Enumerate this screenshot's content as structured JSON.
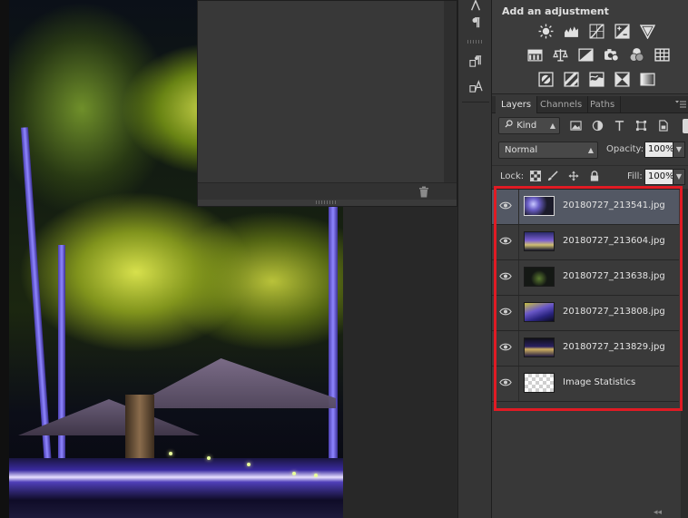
{
  "adjustments": {
    "title": "Add an adjustment",
    "rows": [
      [
        "brightness-contrast-icon",
        "levels-icon",
        "curves-icon",
        "exposure-icon",
        "vibrance-icon"
      ],
      [
        "hue-saturation-icon",
        "color-balance-icon",
        "black-white-icon",
        "photo-filter-icon",
        "channel-mixer-icon",
        "color-lookup-icon"
      ],
      [
        "invert-icon",
        "posterize-icon",
        "threshold-icon",
        "selective-color-icon",
        "gradient-map-icon"
      ]
    ]
  },
  "layers_panel": {
    "tabs": [
      {
        "label": "Layers",
        "active": true
      },
      {
        "label": "Channels",
        "active": false
      },
      {
        "label": "Paths",
        "active": false
      }
    ],
    "filter": {
      "kind_label": "Kind"
    },
    "blend_mode": "Normal",
    "opacity_label": "Opacity:",
    "opacity_value": "100%",
    "lock_label": "Lock:",
    "fill_label": "Fill:",
    "fill_value": "100%",
    "layers": [
      {
        "name": "20180727_213541.jpg",
        "selected": true,
        "visible": true,
        "thumb": "night-photo"
      },
      {
        "name": "20180727_213604.jpg",
        "selected": false,
        "visible": true,
        "thumb": "night-photo"
      },
      {
        "name": "20180727_213638.jpg",
        "selected": false,
        "visible": true,
        "thumb": "night-photo"
      },
      {
        "name": "20180727_213808.jpg",
        "selected": false,
        "visible": true,
        "thumb": "night-photo"
      },
      {
        "name": "20180727_213829.jpg",
        "selected": false,
        "visible": true,
        "thumb": "night-photo"
      },
      {
        "name": "Image Statistics",
        "selected": false,
        "visible": true,
        "thumb": "transparent"
      }
    ]
  },
  "colors": {
    "highlight": "#e01b24",
    "panel_bg": "#383838",
    "selected_row": "#535864"
  }
}
